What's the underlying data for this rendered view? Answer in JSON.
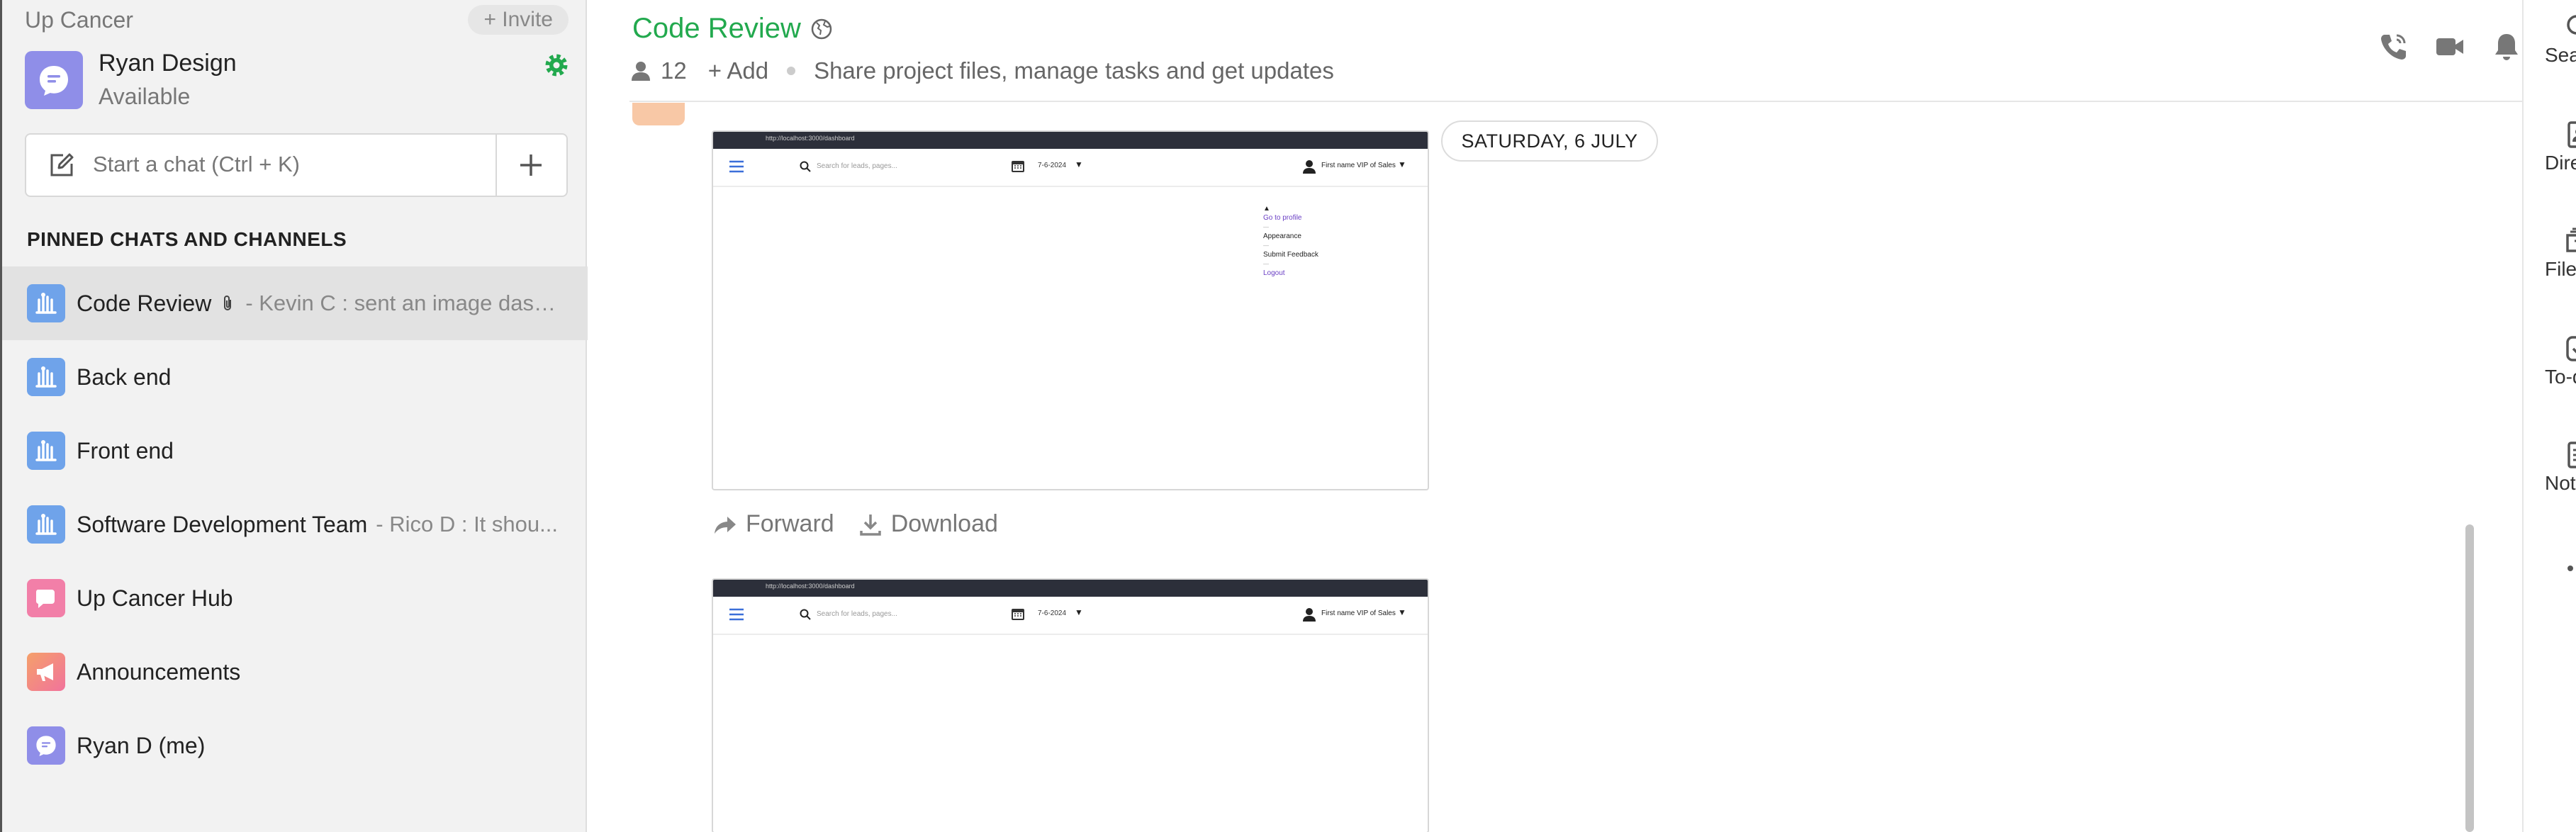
{
  "sidebar": {
    "org_name": "Up Cancer",
    "invite_label": "+ Invite",
    "profile": {
      "name": "Ryan Design",
      "status": "Available"
    },
    "search_placeholder": "Start a chat (Ctrl + K)",
    "section_title": "PINNED CHATS AND CHANNELS",
    "items": [
      {
        "name": "Code Review",
        "preview": "- Kevin C : sent an image dash...",
        "icon": "channel-icon",
        "color": "#6fa3ea",
        "active": true,
        "has_attachment": true
      },
      {
        "name": "Back end",
        "preview": "",
        "icon": "channel-icon",
        "color": "#6fa3ea"
      },
      {
        "name": "Front end",
        "preview": "",
        "icon": "channel-icon",
        "color": "#6fa3ea"
      },
      {
        "name": "Software Development Team",
        "preview": "- Rico D : It shou...",
        "icon": "channel-icon",
        "color": "#6fa3ea"
      },
      {
        "name": "Up Cancer Hub",
        "preview": "",
        "icon": "hub-icon",
        "color": "#f27fa8"
      },
      {
        "name": "Announcements",
        "preview": "",
        "icon": "megaphone-icon",
        "color": "#f5a06a"
      },
      {
        "name": "Ryan D (me)",
        "preview": "",
        "icon": "chat-bubble-icon",
        "color": "#8f8ee8"
      }
    ]
  },
  "channel": {
    "title": "Code Review",
    "member_count": "12",
    "add_label": "+ Add",
    "description": "Share project files, manage tasks and get updates"
  },
  "messages": {
    "date_label": "SATURDAY, 6 JULY",
    "actions": {
      "forward": "Forward",
      "download": "Download"
    },
    "screenshot1": {
      "url": "http://localhost:3000/dashboard",
      "search_placeholder": "Search for leads, pages...",
      "date": "7-6-2024",
      "user": "First name VIP of Sales",
      "menu": [
        {
          "label": "Go to profile",
          "kind": "link"
        },
        {
          "label": "Appearance",
          "kind": "text"
        },
        {
          "label": "Submit Feedback",
          "kind": "text"
        },
        {
          "label": "Logout",
          "kind": "link"
        }
      ]
    },
    "screenshot2": {
      "url": "http://localhost:3000/dashboard",
      "search_placeholder": "Search for leads, pages...",
      "date": "7-6-2024",
      "user": "First name VIP of Sales"
    }
  },
  "rail": {
    "items": [
      {
        "label": "Search",
        "icon": "search-icon"
      },
      {
        "label": "Directory",
        "icon": "directory-icon"
      },
      {
        "label": "Files",
        "icon": "files-icon"
      },
      {
        "label": "To-dos",
        "icon": "todo-icon"
      },
      {
        "label": "Notes",
        "icon": "notes-icon"
      },
      {
        "label": "",
        "icon": "more-icon"
      }
    ]
  },
  "colors": {
    "accent_green": "#22a94e",
    "channel_blue": "#6fa3ea",
    "profile_purple": "#8f8ee8"
  }
}
